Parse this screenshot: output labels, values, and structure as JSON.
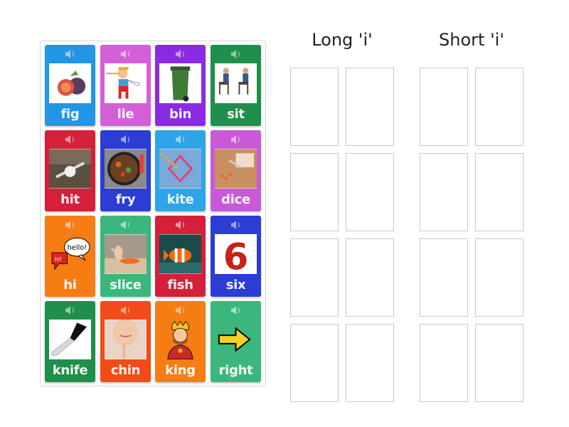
{
  "groups": [
    {
      "title": "Long 'i'",
      "slot_count": 8
    },
    {
      "title": "Short 'i'",
      "slot_count": 8
    }
  ],
  "cards": [
    {
      "word": "fig",
      "color": "#2196e6",
      "image": "fig-fruit",
      "audio_icon": "speaker-icon"
    },
    {
      "word": "lie",
      "color": "#d460d9",
      "image": "pinocchio",
      "audio_icon": "speaker-icon"
    },
    {
      "word": "bin",
      "color": "#8a2be3",
      "image": "green-wheelie-bin",
      "audio_icon": "speaker-icon"
    },
    {
      "word": "sit",
      "color": "#1f8f4b",
      "image": "people-sitting",
      "audio_icon": "speaker-icon"
    },
    {
      "word": "hit",
      "color": "#d5203a",
      "image": "baseball-hit",
      "audio_icon": "speaker-icon"
    },
    {
      "word": "fry",
      "color": "#2b3dd4",
      "image": "frying-pan-food",
      "audio_icon": "speaker-icon"
    },
    {
      "word": "kite",
      "color": "#2ea5e8",
      "image": "rainbow-kite",
      "audio_icon": "speaker-icon"
    },
    {
      "word": "dice",
      "color": "#c85ad8",
      "image": "dicing-carrot",
      "audio_icon": "speaker-icon"
    },
    {
      "word": "hi",
      "color": "#f57d14",
      "image": "hi-hello-bubbles",
      "audio_icon": "speaker-icon"
    },
    {
      "word": "slice",
      "color": "#3bb77e",
      "image": "slicing-carrot",
      "audio_icon": "speaker-icon"
    },
    {
      "word": "fish",
      "color": "#d5203a",
      "image": "clownfish",
      "audio_icon": "speaker-icon"
    },
    {
      "word": "six",
      "color": "#2b3dd4",
      "image": "number-six",
      "audio_icon": "speaker-icon"
    },
    {
      "word": "knife",
      "color": "#1f8f4b",
      "image": "kitchen-knife",
      "audio_icon": "speaker-icon"
    },
    {
      "word": "chin",
      "color": "#f24b18",
      "image": "woman-chin",
      "audio_icon": "speaker-icon"
    },
    {
      "word": "king",
      "color": "#f57d14",
      "image": "cartoon-king",
      "audio_icon": "speaker-icon"
    },
    {
      "word": "right",
      "color": "#3bb77e",
      "image": "yellow-arrow-right",
      "audio_icon": "speaker-icon"
    }
  ]
}
